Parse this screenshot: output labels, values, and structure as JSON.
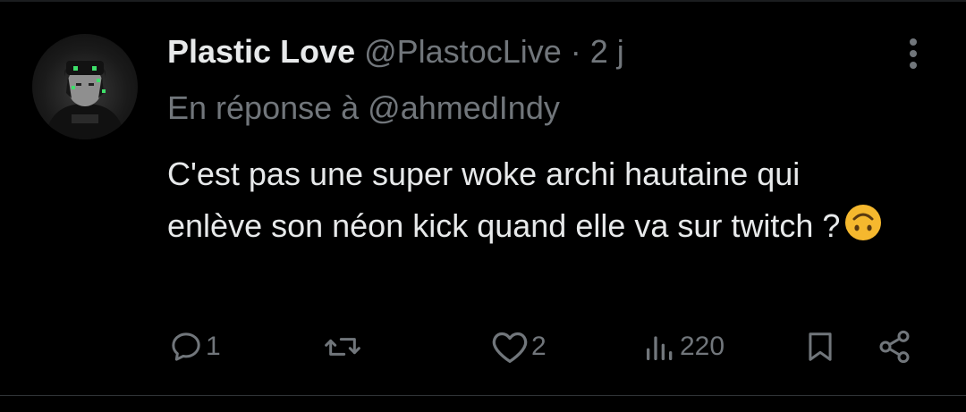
{
  "tweet": {
    "display_name": "Plastic Love",
    "handle": "@PlastocLive",
    "separator": "·",
    "time": "2 j",
    "reply_prefix": "En réponse à",
    "reply_to": "@ahmedIndy",
    "text": "C'est pas une super woke archi hautaine qui enlève son néon kick quand elle va sur twitch ?",
    "emoji": "upside-down-face"
  },
  "actions": {
    "replies": "1",
    "retweets": "",
    "likes": "2",
    "views": "220"
  },
  "icons": {
    "reply": "reply-icon",
    "retweet": "retweet-icon",
    "like": "heart-icon",
    "views": "views-icon",
    "bookmark": "bookmark-icon",
    "share": "share-icon",
    "more": "more-icon"
  },
  "colors": {
    "background": "#000000",
    "text_primary": "#e7e9ea",
    "text_secondary": "#71767b",
    "emoji": "#f5b82e",
    "avatar_accent": "#3ee06a"
  }
}
